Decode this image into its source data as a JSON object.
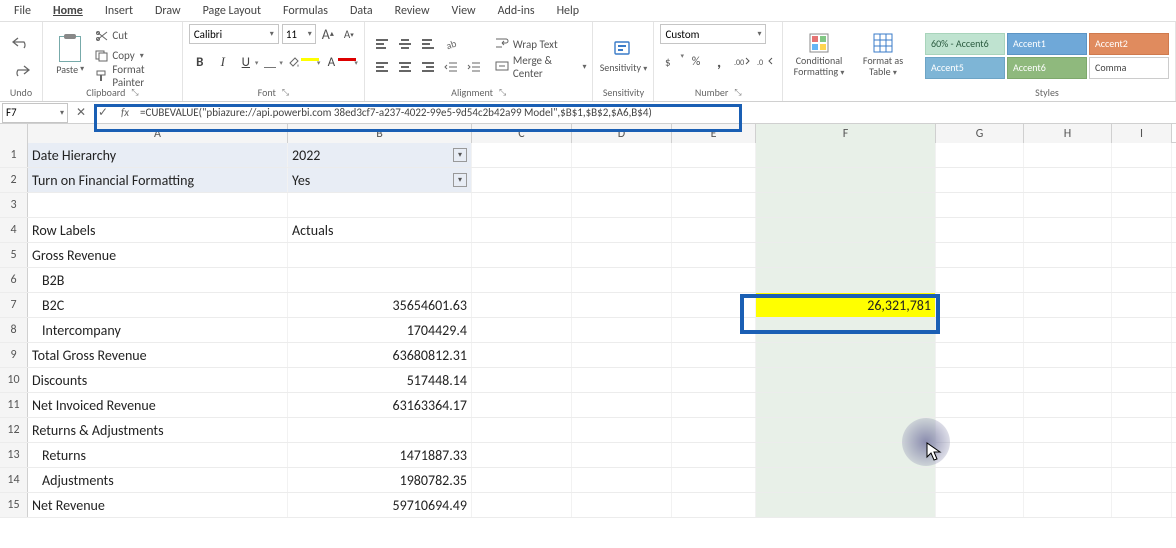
{
  "menu": {
    "file": "File",
    "home": "Home",
    "insert": "Insert",
    "draw": "Draw",
    "page_layout": "Page Layout",
    "formulas": "Formulas",
    "data": "Data",
    "review": "Review",
    "view": "View",
    "addins": "Add-ins",
    "help": "Help"
  },
  "ribbon": {
    "undo_group": "Undo",
    "clipboard": {
      "label": "Clipboard",
      "paste": "Paste",
      "cut": "Cut",
      "copy": "Copy",
      "format_painter": "Format Painter"
    },
    "font": {
      "label": "Font",
      "name": "Calibri",
      "size": "11",
      "increase_hint": "A",
      "decrease_hint": "A",
      "bold": "B",
      "italic": "I",
      "underline": "U",
      "font_color_letter": "A"
    },
    "alignment": {
      "label": "Alignment",
      "wrap": "Wrap Text",
      "merge": "Merge & Center"
    },
    "sensitivity": {
      "label": "Sensitivity",
      "btn": "Sensitivity"
    },
    "number": {
      "label": "Number",
      "format": "Custom",
      "percent": "%",
      "comma": ","
    },
    "cond_format": "Conditional Formatting",
    "format_table": "Format as Table",
    "styles": {
      "label": "Styles",
      "s60a6": "60% - Accent6",
      "a1": "Accent1",
      "a2": "Accent2",
      "a5": "Accent5",
      "a6": "Accent6",
      "comma": "Comma"
    }
  },
  "name_box": "F7",
  "formula": "=CUBEVALUE(\"pbiazure://api.powerbi.com 38ed3cf7-a237-4022-99e5-9d54c2b42a99 Model\",$B$1,$B$2,$A6,B$4)",
  "columns": [
    "A",
    "B",
    "C",
    "D",
    "E",
    "F",
    "G",
    "H",
    "I"
  ],
  "rows": [
    {
      "n": "1",
      "a": "Date Hierarchy",
      "b": "2022",
      "filter": true,
      "fill": true
    },
    {
      "n": "2",
      "a": "Turn on Financial Formatting",
      "b": "Yes",
      "filter": true,
      "fill": true
    },
    {
      "n": "3",
      "a": "",
      "b": ""
    },
    {
      "n": "4",
      "a": "Row Labels",
      "b": "Actuals"
    },
    {
      "n": "5",
      "a": "Gross Revenue",
      "b": ""
    },
    {
      "n": "6",
      "a": "B2B",
      "b": "",
      "indent": true
    },
    {
      "n": "7",
      "a": "B2C",
      "b": "35654601.63",
      "indent": true,
      "f": "26,321,781"
    },
    {
      "n": "8",
      "a": "Intercompany",
      "b": "1704429.4",
      "indent": true
    },
    {
      "n": "9",
      "a": "Total Gross Revenue",
      "b": "63680812.31"
    },
    {
      "n": "10",
      "a": "Discounts",
      "b": "517448.14"
    },
    {
      "n": "11",
      "a": "Net Invoiced Revenue",
      "b": "63163364.17"
    },
    {
      "n": "12",
      "a": "Returns & Adjustments",
      "b": ""
    },
    {
      "n": "13",
      "a": "Returns",
      "b": "1471887.33",
      "indent": true
    },
    {
      "n": "14",
      "a": "Adjustments",
      "b": "1980782.35",
      "indent": true
    },
    {
      "n": "15",
      "a": "Net Revenue",
      "b": "59710694.49"
    }
  ]
}
